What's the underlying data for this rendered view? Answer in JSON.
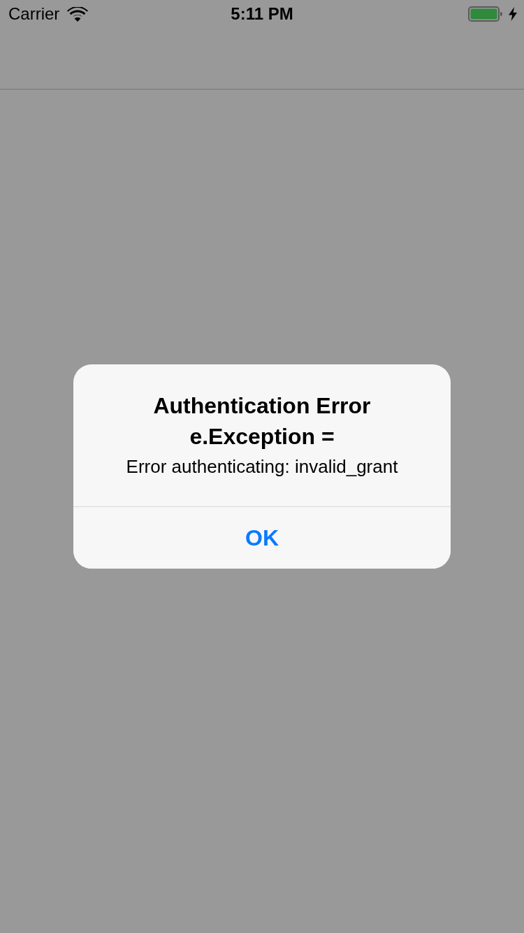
{
  "status_bar": {
    "carrier": "Carrier",
    "time": "5:11 PM",
    "charging": true
  },
  "alert": {
    "title": "Authentication Error\ne.Exception =",
    "message": "Error authenticating: invalid_grant",
    "buttons": [
      {
        "label": "OK",
        "kind": "default"
      }
    ]
  }
}
